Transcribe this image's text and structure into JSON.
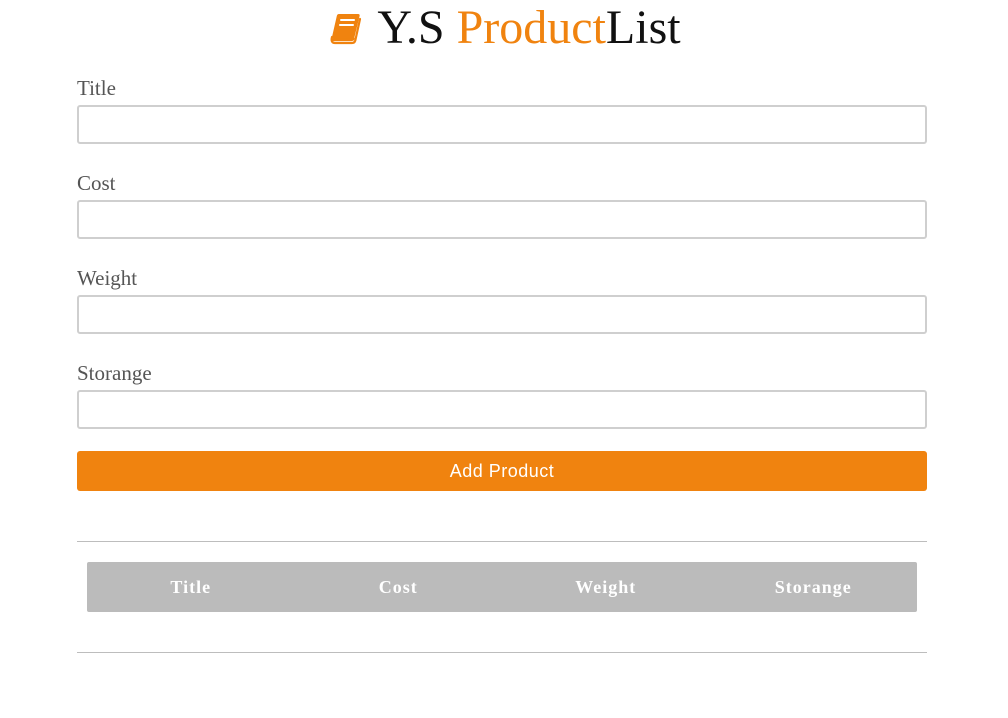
{
  "header": {
    "icon": "book-icon",
    "title_prefix": "Y.S ",
    "title_accent": "Product",
    "title_suffix": "List",
    "accent_color": "#f0830f"
  },
  "form": {
    "fields": [
      {
        "label": "Title",
        "value": "",
        "placeholder": ""
      },
      {
        "label": "Cost",
        "value": "",
        "placeholder": ""
      },
      {
        "label": "Weight",
        "value": "",
        "placeholder": ""
      },
      {
        "label": "Storange",
        "value": "",
        "placeholder": ""
      }
    ],
    "submit_label": "Add Product"
  },
  "table": {
    "headers": [
      "Title",
      "Cost",
      "Weight",
      "Storange"
    ],
    "rows": []
  }
}
